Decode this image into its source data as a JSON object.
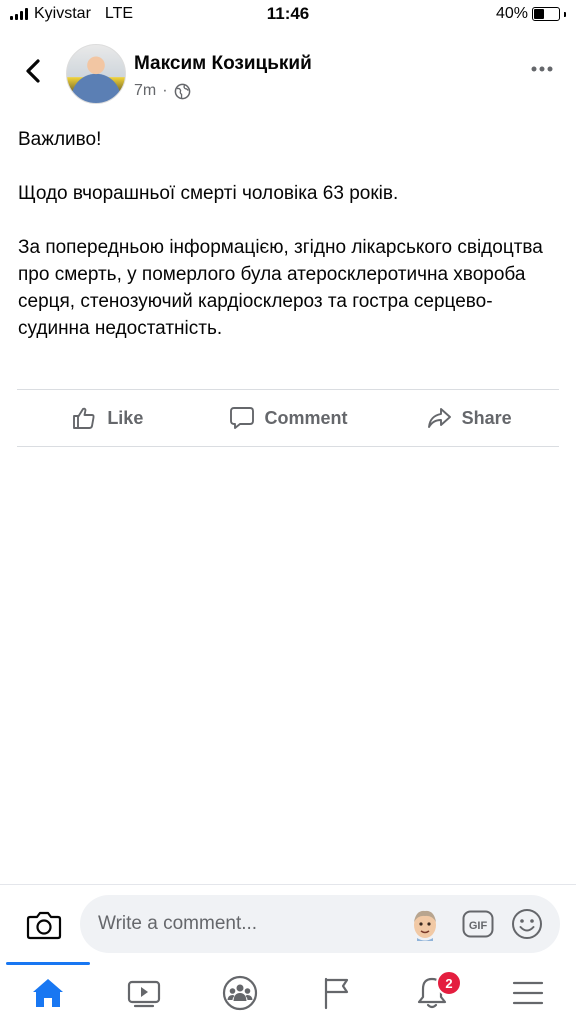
{
  "status_bar": {
    "carrier": "Kyivstar",
    "network": "LTE",
    "time": "11:46",
    "battery_percent": "40%",
    "battery_level": 0.4
  },
  "post": {
    "author": "Максим Козицький",
    "time_ago": "7m",
    "separator": "·",
    "privacy_icon": "globe-icon",
    "paragraphs": [
      "Важливо!",
      "Щодо вчорашньої смерті чоловіка 63 років.",
      "За попередньою інформацією, згідно лікарського свідоцтва про смерть, у померлого була атеросклеротична хвороба серця, стенозуючий кардіосклероз та гостра серцево-судинна недостатність."
    ]
  },
  "actions": {
    "like": "Like",
    "comment": "Comment",
    "share": "Share"
  },
  "comment_bar": {
    "placeholder": "Write a comment...",
    "gif_label": "GIF"
  },
  "nav": {
    "items": [
      "home-icon",
      "watch-icon",
      "groups-icon",
      "pages-icon",
      "notifications-icon",
      "menu-icon"
    ],
    "notification_count": "2",
    "active_color": "#1877f2",
    "badge_color": "#e41e3f"
  }
}
